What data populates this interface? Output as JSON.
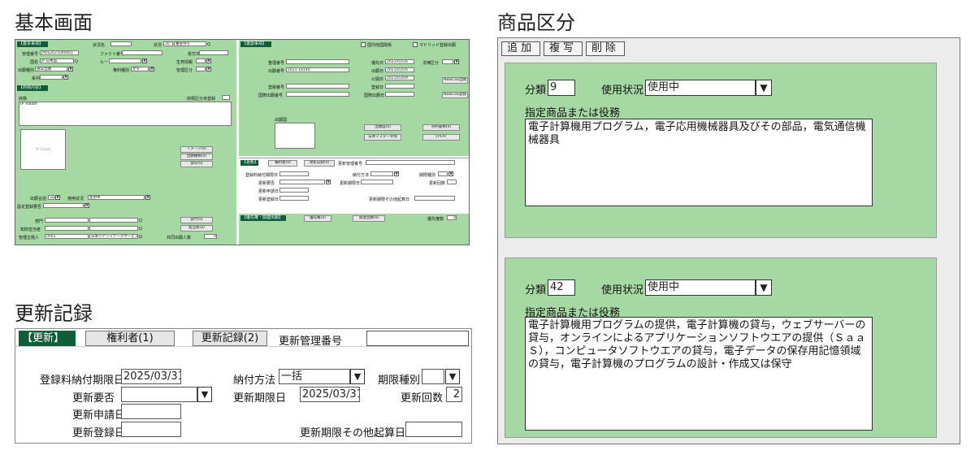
{
  "titles": {
    "basic": "基本画面",
    "product": "商品区分",
    "renewal": "更新記録"
  },
  "basic": {
    "left_header": "【基本事項】",
    "status_label": "状況名",
    "status_label2": "状況",
    "status_code": "20",
    "status_value": "審査待ち",
    "mgmt_no_label": "管理番号",
    "mgmt_no": "JPDS2021000001",
    "family_label": "ファミリ番号",
    "receipt_label": "受付日",
    "country_label": "国名",
    "country_value": "JP 日本国",
    "route_label": "ルート",
    "origin_label": "生死情報",
    "app_type_label": "出願種別",
    "app_type_value": "通常出願",
    "rights_type_label": "権利種別",
    "rights_type_value": "文字",
    "mgmt_class_label": "管理区分",
    "item_label": "系列",
    "mark_header": "【商標内容】",
    "mark_label": "商標",
    "mark_class_label": "商標区分未登録",
    "mark_text": "IP Vision",
    "image_text": "IP Vision",
    "btn_image": "イメージ(0)",
    "btn_appdata": "出願種類(0)",
    "btn_other": "部分(0)",
    "app_lang_label": "出願言語",
    "app_lang_value": "日",
    "usage_label": "使用状況",
    "usage_value": "使用中",
    "flag_label": "設定登録要否",
    "dept_label": "部門",
    "owner_label": "知財担当者",
    "applicant_label": "管理主題人",
    "applicant_code": "0001",
    "applicant_name": "日本パテントデータサービス",
    "btn_dept": "部門(0)",
    "btn_owner": "担当者(0)",
    "right_count_label": "共同出願人数",
    "right_count": "0",
    "right_header": "【書誌事項】",
    "chk_label": "国内他国関係",
    "chk_label2": "マドリッド登録出願",
    "reg_no_label": "整理番号",
    "app_no_label": "出願番号",
    "app_no": "2021-18140",
    "pub_date_label": "優先日",
    "pub_date": "2021/03/16",
    "app_date_label": "出願日",
    "app_date": "2021/03/16",
    "pub_no_label": "公開日",
    "pub_no": "2021/03/09",
    "reg_date_label": "登録日",
    "intl_app_label": "国際出願日",
    "reg_label": "登録番号",
    "intl_reg_label": "国際出願番号",
    "rights_class_label": "法律区分",
    "btn_newcss": "NewCSS出願",
    "btn_newcss2": "NewCSS登録",
    "memo_label": "出願国",
    "btn_appdoc": "出願国(0)",
    "btn_master": "法律マスター参照",
    "btn_law": "条約書類(0)",
    "btn_jplat": "J-PLAT",
    "update_tab": "【更新】",
    "update_tab2": "権利者(0)",
    "update_tab3": "更新記録(0)",
    "update_mgmt": "更新管理番号",
    "fee_label": "登録料納付期限日",
    "pay_label": "納付方法",
    "term_label": "期限種別",
    "need_label": "更新要否",
    "renew_date_label": "更新期限日",
    "renew_count_label": "更新回数",
    "apply_label": "更新申請日",
    "regd_label": "更新登録日",
    "other_label": "更新期限その他起算日",
    "bottom_header": "【優先権・関連出願】",
    "bottom_btn1": "優先権(0)",
    "bottom_btn2": "関連出願(0)",
    "bottom_label": "優先権数",
    "bottom_count": "0"
  },
  "product": {
    "toolbar": [
      "追加",
      "複写",
      "削除"
    ],
    "cards": [
      {
        "class_label": "分類",
        "class_value": "9",
        "usage_label": "使用状況",
        "usage_value": "使用中",
        "goods_label": "指定商品または役務",
        "goods_text": "電子計算機用プログラム，電子応用機械器具及びその部品，電気通信機械器具"
      },
      {
        "class_label": "分類",
        "class_value": "42",
        "usage_label": "使用状況",
        "usage_value": "使用中",
        "goods_label": "指定商品または役務",
        "goods_text": "電子計算機用プログラムの提供，電子計算機の貸与，ウェブサーバーの貸与，オンラインによるアプリケーションソフトウエアの提供（ＳａａＳ），コンピュータソフトウエアの貸与，電子データの保存用記憶領域の貸与，電子計算機のプログラムの設計・作成又は保守"
      }
    ]
  },
  "renewal": {
    "tab_active": "【更新】",
    "tab_rights": "権利者(1)",
    "tab_records": "更新記録(2)",
    "mgmt_no_label": "更新管理番号",
    "mgmt_no_value": "",
    "fee_deadline_label": "登録料納付期限日",
    "fee_deadline_value": "2025/03/31",
    "payment_label": "納付方法",
    "payment_value": "一括",
    "term_type_label": "期限種別",
    "term_type_value": "",
    "need_label": "更新要否",
    "need_value": "",
    "renew_deadline_label": "更新期限日",
    "renew_deadline_value": "2025/03/31",
    "renew_count_label": "更新回数",
    "renew_count_value": "2",
    "apply_date_label": "更新申請日",
    "apply_date_value": "",
    "reg_date_label": "更新登録日",
    "reg_date_value": "",
    "other_start_label": "更新期限その他起算日",
    "other_start_value": ""
  },
  "icons": {
    "dropdown": "▼",
    "search": "Q"
  },
  "colors": {
    "panel_green": "#a6d8a3",
    "header_green": "#0f5d3a"
  }
}
